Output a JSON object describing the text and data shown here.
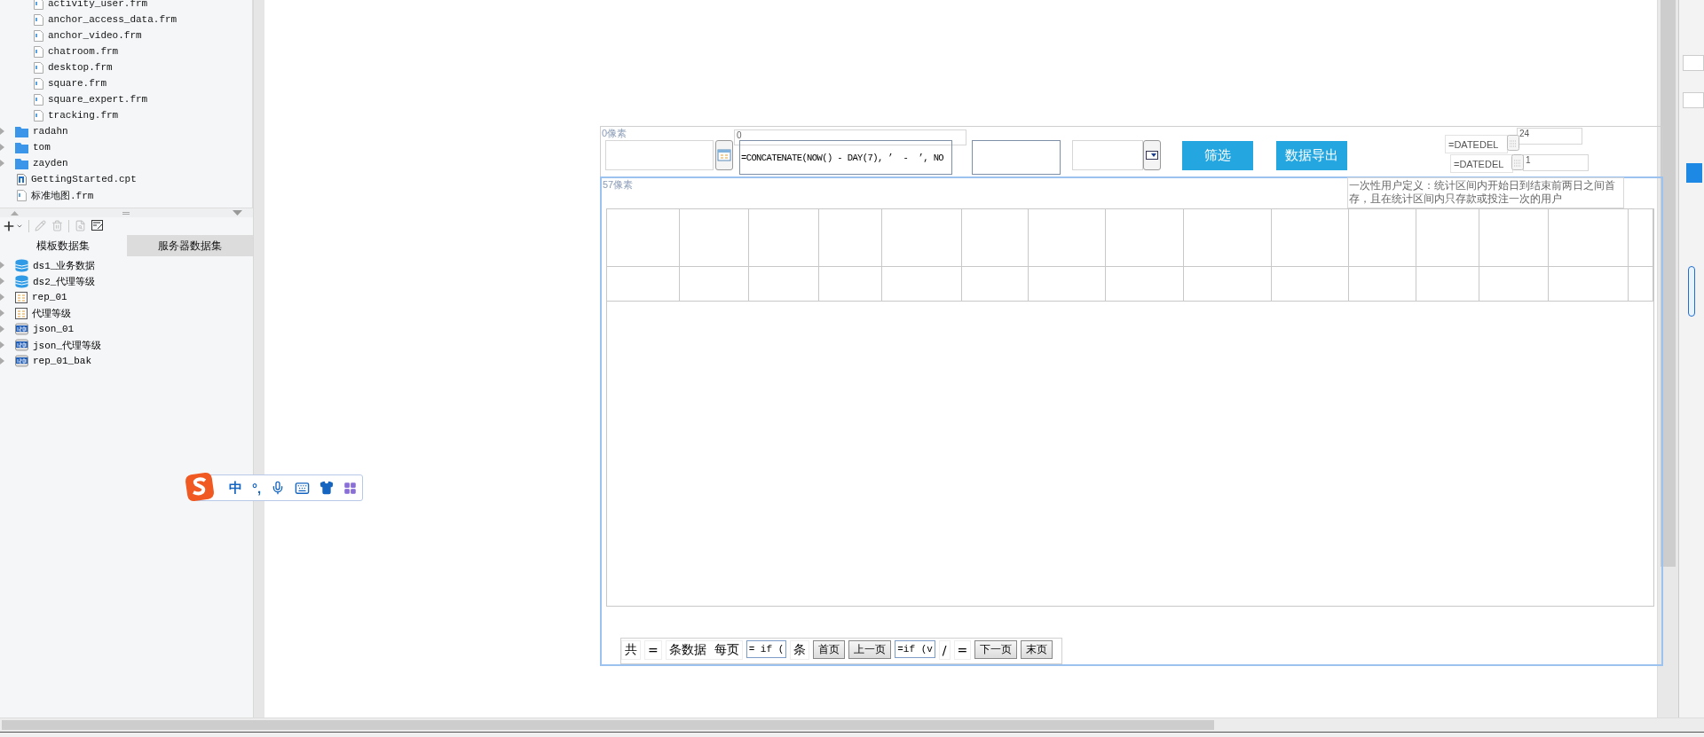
{
  "template_tree": {
    "nested_files": [
      {
        "kind": "form",
        "name": "activity_user.frm"
      },
      {
        "kind": "form",
        "name": "anchor_access_data.frm"
      },
      {
        "kind": "form",
        "name": "anchor_video.frm"
      },
      {
        "kind": "form",
        "name": "chatroom.frm"
      },
      {
        "kind": "form",
        "name": "desktop.frm"
      },
      {
        "kind": "form",
        "name": "square.frm"
      },
      {
        "kind": "form",
        "name": "square_expert.frm"
      },
      {
        "kind": "form",
        "name": "tracking.frm"
      }
    ],
    "items": [
      {
        "kind": "folder",
        "name": "radahn",
        "expanded": false
      },
      {
        "kind": "folder",
        "name": "tom",
        "expanded": false
      },
      {
        "kind": "folder",
        "name": "zayden",
        "expanded": false
      },
      {
        "kind": "report",
        "name": "GettingStarted.cpt"
      },
      {
        "kind": "form",
        "name": "标准地图.frm"
      }
    ]
  },
  "dataset_toolbar": [
    {
      "kind": "add",
      "disabled": false
    },
    {
      "kind": "edit",
      "disabled": true
    },
    {
      "kind": "delete",
      "disabled": true
    },
    {
      "kind": "preview",
      "disabled": true
    },
    {
      "kind": "edit_data",
      "disabled": false
    }
  ],
  "dataset_tabs": [
    {
      "label": "模板数据集",
      "selected": true
    },
    {
      "label": "服务器数据集",
      "selected": false
    }
  ],
  "datasets": [
    {
      "kind": "database",
      "name": "ds1_业务数据",
      "expanded": false
    },
    {
      "kind": "database",
      "name": "ds2_代理等级",
      "expanded": false
    },
    {
      "kind": "table",
      "name": "rep_01",
      "expanded": false
    },
    {
      "kind": "table",
      "name": "代理等级",
      "expanded": false
    },
    {
      "kind": "json",
      "name": "json_01",
      "expanded": false
    },
    {
      "kind": "json",
      "name": "json_代理等级",
      "expanded": false
    },
    {
      "kind": "json",
      "name": "rep_01_bak",
      "expanded": false
    }
  ],
  "parameter_pane": {
    "height_label": "0像素",
    "zero_label": "0",
    "formula_field": {
      "value": "=CONCATENATE(NOW() - DAY(7), ’  -  ’, NO"
    },
    "filter_button": "筛选",
    "export_button": "数据导出",
    "date_params": [
      {
        "formula": "=DATEDEL",
        "value": "24"
      },
      {
        "formula": "=DATEDEL",
        "value": "1"
      }
    ]
  },
  "body": {
    "height_label": "57像素",
    "description": "一次性用户定义：统计区间内开始日到结束前两日之间首存，且在统计区间内只存款或投注一次的用户",
    "pager": [
      {
        "kind": "text",
        "text": "共"
      },
      {
        "kind": "text",
        "text": "="
      },
      {
        "kind": "text",
        "text": "条数据  每页"
      },
      {
        "kind": "input",
        "text": "= if ("
      },
      {
        "kind": "text",
        "text": "条"
      },
      {
        "kind": "button",
        "text": "首页"
      },
      {
        "kind": "button",
        "text": "上一页"
      },
      {
        "kind": "input",
        "text": "=if (v"
      },
      {
        "kind": "text",
        "text": "/"
      },
      {
        "kind": "text",
        "text": "="
      },
      {
        "kind": "button",
        "text": "下一页"
      },
      {
        "kind": "button",
        "text": "末页"
      }
    ]
  },
  "ime_toolbar": {
    "mode": "中",
    "punctuation": "°,"
  }
}
